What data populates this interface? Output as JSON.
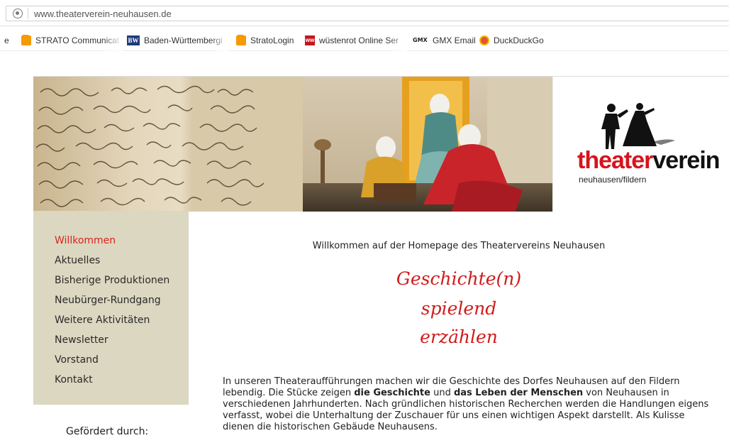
{
  "browser": {
    "url": "www.theaterverein-neuhausen.de",
    "bookmarks": [
      {
        "label": "STRATO Communicat",
        "icon": "strato-icon"
      },
      {
        "label": "Baden-Württembergi",
        "icon": "bw-icon"
      },
      {
        "label": "StratoLogin",
        "icon": "strato-icon"
      },
      {
        "label": "wüstenrot Online Ser",
        "icon": "wuestenrot-icon"
      },
      {
        "label": "GMX Email",
        "icon": "gmx-icon"
      },
      {
        "label": "DuckDuckGo",
        "icon": "duckduckgo-icon"
      }
    ],
    "bookmark_icon_text": {
      "bw": "BW",
      "ww": "ww",
      "gmx": "GMX"
    },
    "overflow_bookmark": "e"
  },
  "logo": {
    "word_part1": "theater",
    "word_part2": "verein",
    "subtitle": "neuhausen/fildern",
    "colors": {
      "red": "#d6141e",
      "black": "#111111"
    }
  },
  "nav": {
    "items": [
      {
        "label": "Willkommen",
        "active": true
      },
      {
        "label": "Aktuelles"
      },
      {
        "label": "Bisherige Produktionen"
      },
      {
        "label": "Neubürger-Rundgang"
      },
      {
        "label": "Weitere Aktivitäten"
      },
      {
        "label": "Newsletter"
      },
      {
        "label": "Vorstand"
      },
      {
        "label": "Kontakt"
      }
    ],
    "active_color": "#d9251c",
    "background": "#dcd7c0"
  },
  "sponsor": {
    "label": "Gefördert durch:"
  },
  "main": {
    "welcome": "Willkommen auf der Homepage des Theatervereins Neuhausen",
    "motto": [
      "Geschichte(n)",
      "spielend",
      "erzählen"
    ],
    "motto_color": "#d11a1a",
    "intro": {
      "part1": "In unseren Theateraufführungen machen wir die Geschichte des Dorfes Neuhausen auf den Fildern lebendig. Die Stücke zeigen ",
      "bold1": "die Geschichte",
      "part2": " und ",
      "bold2": "das Leben der Menschen",
      "part3": " von Neuhausen in verschiedenen Jahrhunderten. Nach gründlichen historischen Recherchen werden die Handlungen eigens verfasst, wobei die Unterhaltung der Zuschauer für uns einen wichtigen Aspekt darstellt. Als Kulisse dienen die historischen Gebäude Neuhausens."
    }
  }
}
